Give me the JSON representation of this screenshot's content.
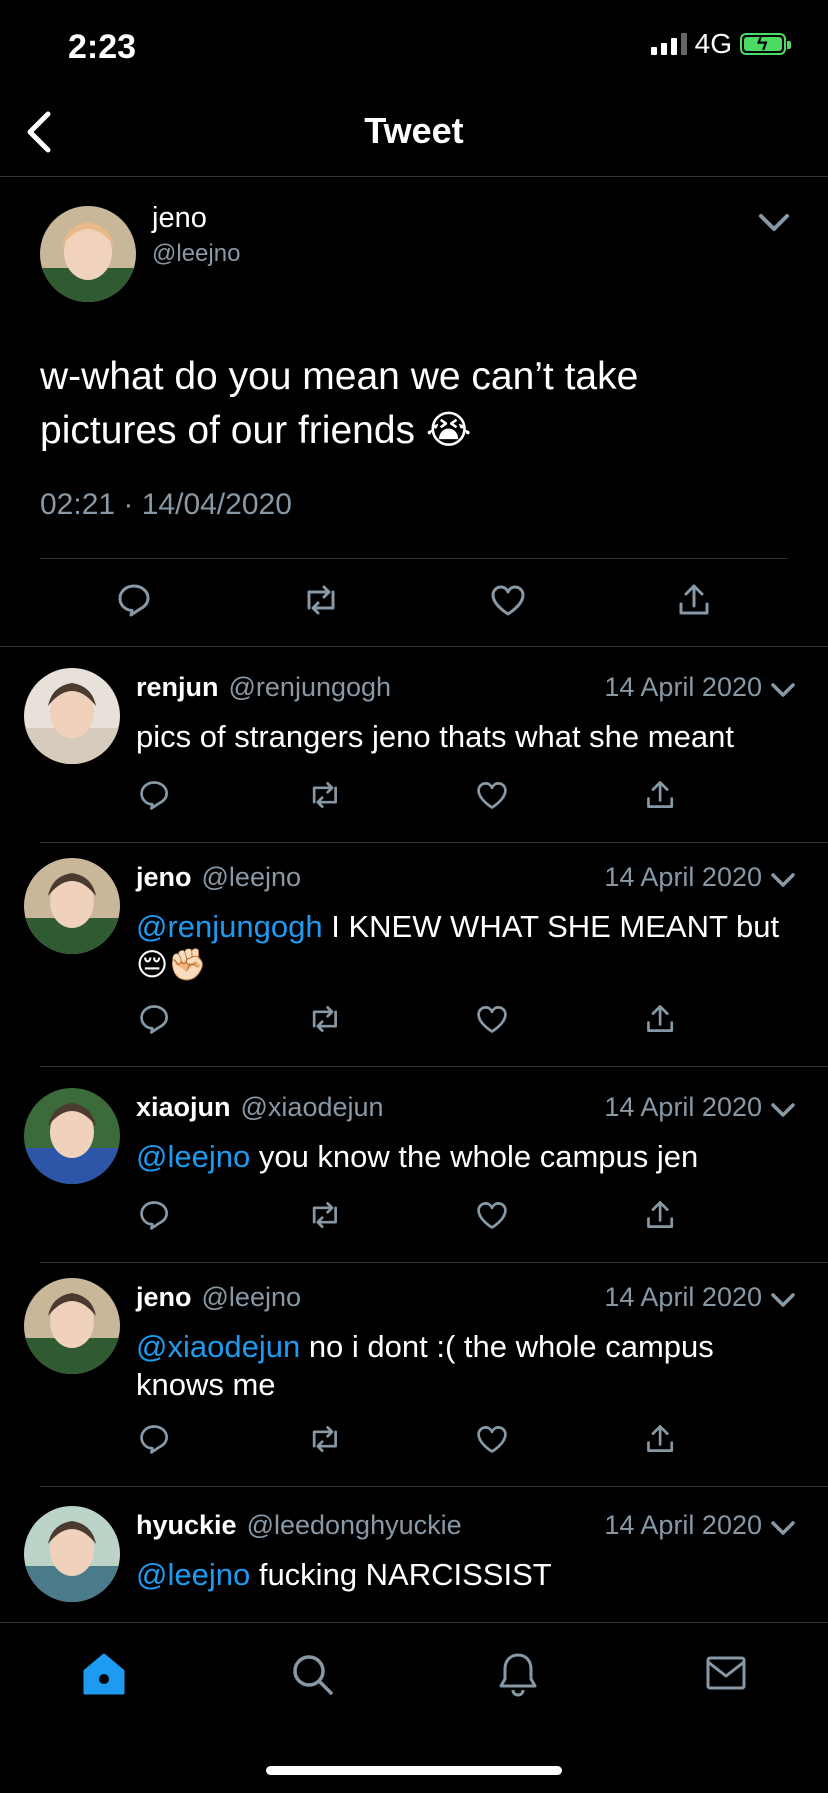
{
  "status_bar": {
    "time": "2:23",
    "network": "4G"
  },
  "nav": {
    "title": "Tweet"
  },
  "main_tweet": {
    "name": "jeno",
    "handle": "@leejno",
    "text": "w-what do you mean we can’t take pictures of our friends 😭",
    "timestamp": "02:21 · 14/04/2020",
    "avatar_icon": "avatar-photo"
  },
  "replies": [
    {
      "name": "renjun",
      "handle": "@renjungogh",
      "date": "14 April 2020",
      "mention": "",
      "text": "pics of strangers jeno thats what she meant"
    },
    {
      "name": "jeno",
      "handle": "@leejno",
      "date": "14 April 2020",
      "mention": "@renjungogh",
      "text": " I KNEW WHAT SHE MEANT but 😔✊🏻"
    },
    {
      "name": "xiaojun",
      "handle": "@xiaodejun",
      "date": "14 April 2020",
      "mention": "@leejno",
      "text": " you know the whole campus jen"
    },
    {
      "name": "jeno",
      "handle": "@leejno",
      "date": "14 April 2020",
      "mention": "@xiaodejun",
      "text": " no i dont :( the whole campus knows me"
    },
    {
      "name": "hyuckie",
      "handle": "@leedonghyuckie",
      "date": "14 April 2020",
      "mention": "@leejno",
      "text": " fucking NARCISSIST"
    }
  ],
  "tabs": [
    "home-icon",
    "search-icon",
    "bell-icon",
    "mail-icon"
  ],
  "colors": {
    "accent": "#1d9bf0",
    "muted": "#8899a6",
    "background": "#000000",
    "battery": "#4cd964"
  }
}
